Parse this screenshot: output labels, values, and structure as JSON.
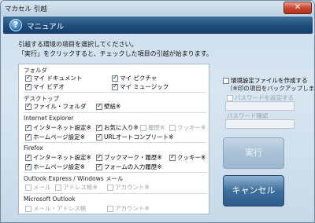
{
  "window": {
    "title": "マカセル 引越",
    "close": "✕"
  },
  "header": {
    "icon": "help-icon",
    "title": "マニュアル",
    "icon_glyph": "?"
  },
  "intro": {
    "line1": "引越する環境の項目を選択してください。",
    "line2": "「実行」をクリックすると、チェックした項目の引越が始まります。"
  },
  "groups": {
    "folder": {
      "title": "フォルダ",
      "items": [
        {
          "label": "マイ ドキュメント",
          "checked": true
        },
        {
          "label": "マイ ピクチャ",
          "checked": true
        },
        {
          "label": "マイ ビデオ",
          "checked": true
        },
        {
          "label": "マイ ミュージック",
          "checked": true
        }
      ]
    },
    "desktop": {
      "title": "デスクトップ",
      "items": [
        {
          "label": "ファイル・フォルダ",
          "checked": true
        },
        {
          "label": "壁紙※",
          "checked": true
        }
      ]
    },
    "ie": {
      "title": "Internet Explorer",
      "items": [
        {
          "label": "インターネット設定※",
          "checked": true
        },
        {
          "label": "お気に入り※",
          "checked": true
        },
        {
          "label": "履歴※",
          "checked": false
        },
        {
          "label": "クッキー※",
          "checked": false
        },
        {
          "label": "ホームページ設定※",
          "checked": true
        },
        {
          "label": "URLオートコンプリート※",
          "checked": true
        }
      ]
    },
    "firefox": {
      "title": "Firefox",
      "items": [
        {
          "label": "インターネット設定※",
          "checked": true
        },
        {
          "label": "ブックマーク・履歴※",
          "checked": true
        },
        {
          "label": "クッキー※",
          "checked": true
        },
        {
          "label": "ホームページ設定※",
          "checked": true
        },
        {
          "label": "フォームの入力履歴※",
          "checked": true
        }
      ]
    },
    "outlook_express": {
      "title": "Outlook Express / Windows メール",
      "items": [
        {
          "label": "メール",
          "checked": false
        },
        {
          "label": "アドレス帳※",
          "checked": false
        },
        {
          "label": "アカウント※",
          "checked": false
        }
      ]
    },
    "outlook": {
      "title": "Microsoft Outlook",
      "items": [
        {
          "label": "メール・アドレス帳",
          "checked": false
        },
        {
          "label": "アカウント※",
          "checked": false
        }
      ]
    }
  },
  "options": {
    "env_file_label": "環境設定ファイルを作成する",
    "env_file_note": "（※印の項目をバックアップします）",
    "password_set_label": "パスワードを設定する",
    "password_label": "パスワード",
    "password_confirm_label": "パスワード確認",
    "password_value": "",
    "password_confirm_value": ""
  },
  "buttons": {
    "execute": "実行",
    "cancel": "キャンセル"
  }
}
